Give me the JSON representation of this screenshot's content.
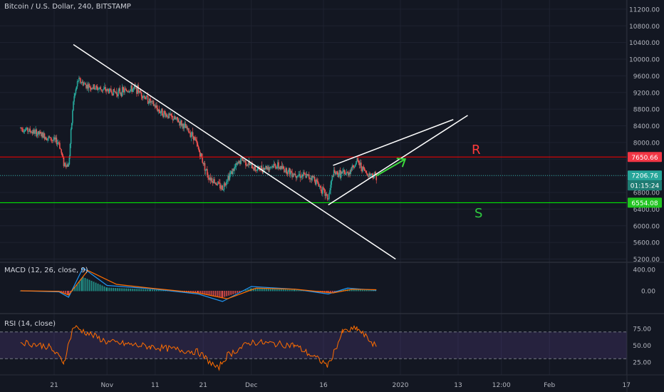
{
  "header": {
    "title": "Bitcoin / U.S. Dollar, 240, BITSTAMP"
  },
  "indicators": {
    "macd_title": "MACD (12, 26, close, 9)",
    "rsi_title": "RSI (14, close)"
  },
  "colors": {
    "background": "#131722",
    "up": "#26a69a",
    "down": "#ef5350",
    "resistance": "#ff0000",
    "support": "#00ff00",
    "trendline": "#ffffff",
    "macd_line": "#2196f3",
    "signal_line": "#ff6d00",
    "rsi_line": "#ff6d00",
    "rsi_band": "#7e57c2"
  },
  "annotations": {
    "resistance_label": "R",
    "support_label": "S"
  },
  "price_badges": {
    "resistance": "7650.66",
    "current": "7206.76",
    "countdown": "01:15:24",
    "support": "6554.08"
  },
  "chart_data": [
    {
      "type": "candlestick",
      "title": "Bitcoin / U.S. Dollar, 240, BITSTAMP",
      "x_ticks": [
        "21",
        "Nov",
        "11",
        "21",
        "Dec",
        "16",
        "2020",
        "13",
        "12:00",
        "Feb",
        "17"
      ],
      "y_ticks": [
        "11200.00",
        "10800.00",
        "10400.00",
        "10000.00",
        "9600.00",
        "9200.00",
        "8800.00",
        "8400.00",
        "8000.00",
        "7600.00",
        "7200.00",
        "6800.00",
        "6400.00",
        "6000.00",
        "5600.00",
        "5200.00"
      ],
      "ylim": [
        5200,
        11500
      ],
      "grid": true,
      "price_path": [
        {
          "date": "2019-10-14",
          "price": 8350
        },
        {
          "date": "2019-10-18",
          "price": 8200
        },
        {
          "date": "2019-10-22",
          "price": 8000
        },
        {
          "date": "2019-10-23",
          "price": 7500
        },
        {
          "date": "2019-10-24",
          "price": 7450
        },
        {
          "date": "2019-10-25",
          "price": 9000
        },
        {
          "date": "2019-10-26",
          "price": 9500
        },
        {
          "date": "2019-10-28",
          "price": 9350
        },
        {
          "date": "2019-11-03",
          "price": 9200
        },
        {
          "date": "2019-11-07",
          "price": 9300
        },
        {
          "date": "2019-11-12",
          "price": 8750
        },
        {
          "date": "2019-11-16",
          "price": 8500
        },
        {
          "date": "2019-11-19",
          "price": 8150
        },
        {
          "date": "2019-11-22",
          "price": 7200
        },
        {
          "date": "2019-11-25",
          "price": 6900
        },
        {
          "date": "2019-11-26",
          "price": 7150
        },
        {
          "date": "2019-11-29",
          "price": 7600
        },
        {
          "date": "2019-12-02",
          "price": 7350
        },
        {
          "date": "2019-12-06",
          "price": 7450
        },
        {
          "date": "2019-12-10",
          "price": 7250
        },
        {
          "date": "2019-12-14",
          "price": 7150
        },
        {
          "date": "2019-12-17",
          "price": 6650
        },
        {
          "date": "2019-12-18",
          "price": 7250
        },
        {
          "date": "2019-12-21",
          "price": 7250
        },
        {
          "date": "2019-12-23",
          "price": 7550
        },
        {
          "date": "2019-12-25",
          "price": 7250
        },
        {
          "date": "2019-12-27",
          "price": 7206.76
        }
      ],
      "levels": [
        {
          "name": "R",
          "value": 7650.66
        },
        {
          "name": "S",
          "value": 6554.08
        },
        {
          "name": "",
          "value": 7206.76
        }
      ],
      "trendlines": [
        {
          "from": [
            "2019-10-25",
            10350
          ],
          "to": [
            "2019-12-31",
            5200
          ]
        },
        {
          "from": [
            "2019-12-17",
            6500
          ],
          "to": [
            "2020-01-15",
            8650
          ]
        },
        {
          "from": [
            "2019-12-18",
            7450
          ],
          "to": [
            "2020-01-12",
            8550
          ]
        }
      ],
      "projection_arrow": {
        "from": [
          "2019-12-27",
          7200
        ],
        "to": [
          "2020-01-02",
          7600
        ]
      }
    },
    {
      "type": "line",
      "title": "MACD (12, 26, close, 9)",
      "y_ticks": [
        "400.00",
        "0.00"
      ],
      "ylim": [
        -300,
        500
      ],
      "series": [
        {
          "name": "",
          "color": "#2196f3",
          "x": [
            "2019-10-14",
            "2019-10-22",
            "2019-10-24",
            "2019-10-27",
            "2019-11-01",
            "2019-11-10",
            "2019-11-20",
            "2019-11-25",
            "2019-12-01",
            "2019-12-10",
            "2019-12-17",
            "2019-12-21",
            "2019-12-27"
          ],
          "values": [
            0,
            -20,
            -120,
            430,
            100,
            40,
            -60,
            -200,
            80,
            30,
            -60,
            50,
            10
          ]
        },
        {
          "name": "",
          "color": "#ff6d00",
          "x": [
            "2019-10-14",
            "2019-10-22",
            "2019-10-24",
            "2019-10-28",
            "2019-11-03",
            "2019-11-10",
            "2019-11-20",
            "2019-11-26",
            "2019-12-02",
            "2019-12-10",
            "2019-12-18",
            "2019-12-22",
            "2019-12-27"
          ],
          "values": [
            0,
            -10,
            -80,
            380,
            120,
            50,
            -40,
            -150,
            50,
            30,
            -40,
            30,
            20
          ]
        }
      ]
    },
    {
      "type": "line",
      "title": "RSI (14, close)",
      "y_ticks": [
        "75.00",
        "50.00",
        "25.00"
      ],
      "ylim": [
        10,
        85
      ],
      "bands": [
        30,
        70
      ],
      "series": [
        {
          "name": "",
          "color": "#ff6d00",
          "x": [
            "2019-10-14",
            "2019-10-20",
            "2019-10-23",
            "2019-10-25",
            "2019-11-01",
            "2019-11-10",
            "2019-11-20",
            "2019-11-24",
            "2019-11-26",
            "2019-12-01",
            "2019-12-10",
            "2019-12-17",
            "2019-12-20",
            "2019-12-23",
            "2019-12-27"
          ],
          "values": [
            55,
            48,
            25,
            78,
            55,
            48,
            40,
            15,
            35,
            55,
            50,
            20,
            70,
            75,
            48
          ]
        }
      ]
    }
  ]
}
